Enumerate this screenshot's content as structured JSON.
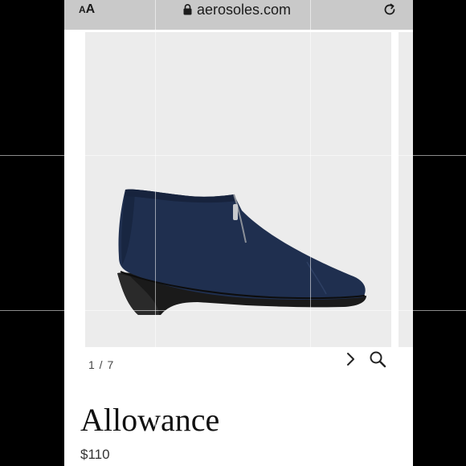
{
  "browser": {
    "text_size_small": "A",
    "text_size_big": "A",
    "domain": "aerosoles.com",
    "lock_icon": "lock-icon",
    "reload_icon": "reload-icon"
  },
  "gallery": {
    "image_description_icon": "shoe-image",
    "pager_text": "1 / 7",
    "next_icon": "chevron-right-icon",
    "zoom_icon": "search-icon"
  },
  "product": {
    "name": "Allowance",
    "price": "$110"
  },
  "colors": {
    "shoe": "#1f2f4f",
    "sole": "#1a1a1a",
    "background": "#ececec",
    "url_bar": "#c9c9c9"
  }
}
